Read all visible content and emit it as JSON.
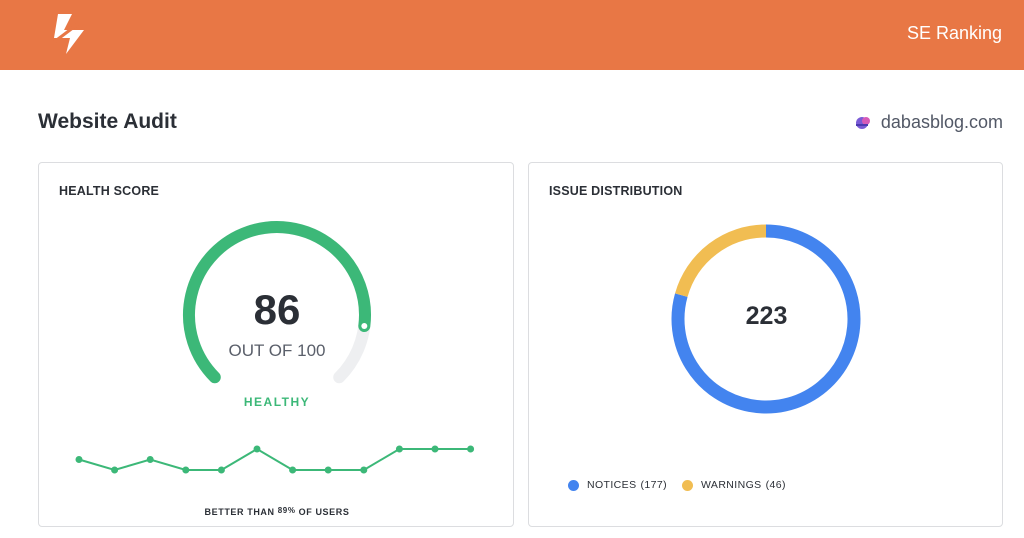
{
  "header": {
    "brand_name": "SE Ranking",
    "logo_icon": "lightning-bolt-icon",
    "background_color": "#e87745"
  },
  "page": {
    "title": "Website Audit",
    "site_icon": "site-favicon-icon",
    "site_name": "dabasblog.com"
  },
  "health_score": {
    "title": "HEALTH SCORE",
    "score": "86",
    "out_of": "OUT OF 100",
    "score_value": 86,
    "score_max": 100,
    "status": "HEALTHY",
    "accent_color": "#3cb878",
    "trend_levels": [
      2,
      1,
      2,
      1,
      1,
      3,
      1,
      1,
      1,
      3,
      3,
      3
    ],
    "footnote": {
      "before": "BETTER THAN",
      "percent": "89%",
      "after": "OF USERS"
    }
  },
  "issue_distribution": {
    "title": "ISSUE DISTRIBUTION",
    "total": "223",
    "segments": [
      {
        "label": "NOTICES",
        "count": 177,
        "count_text": "(177)",
        "color": "#4384ef"
      },
      {
        "label": "WARNINGS",
        "count": 46,
        "count_text": "(46)",
        "color": "#f1bd52"
      }
    ]
  }
}
